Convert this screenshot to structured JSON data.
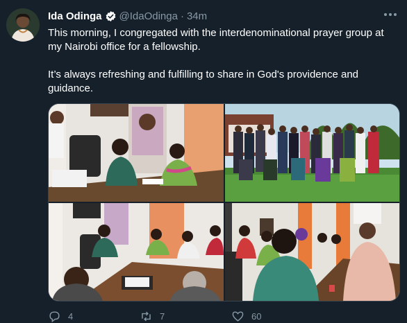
{
  "tweet": {
    "author_name": "Ida Odinga",
    "handle": "@IdaOdinga",
    "separator": "·",
    "time": "34m",
    "paragraphs": [
      "This morning, I congregated with the interdenominational prayer group at my Nairobi office for a fellowship.",
      "It’s always refreshing and fulfilling to share in God's providence and guidance."
    ],
    "photos": [
      "office-meeting-photo",
      "group-photo-garden",
      "conference-table-photo",
      "prayer-room-photo"
    ]
  },
  "actions": {
    "replies": "4",
    "retweets": "7",
    "likes": "60"
  },
  "colors": {
    "background": "#15202b",
    "text_primary": "#ffffff",
    "text_secondary": "#8899a6",
    "verified": "#1d9bf0"
  }
}
